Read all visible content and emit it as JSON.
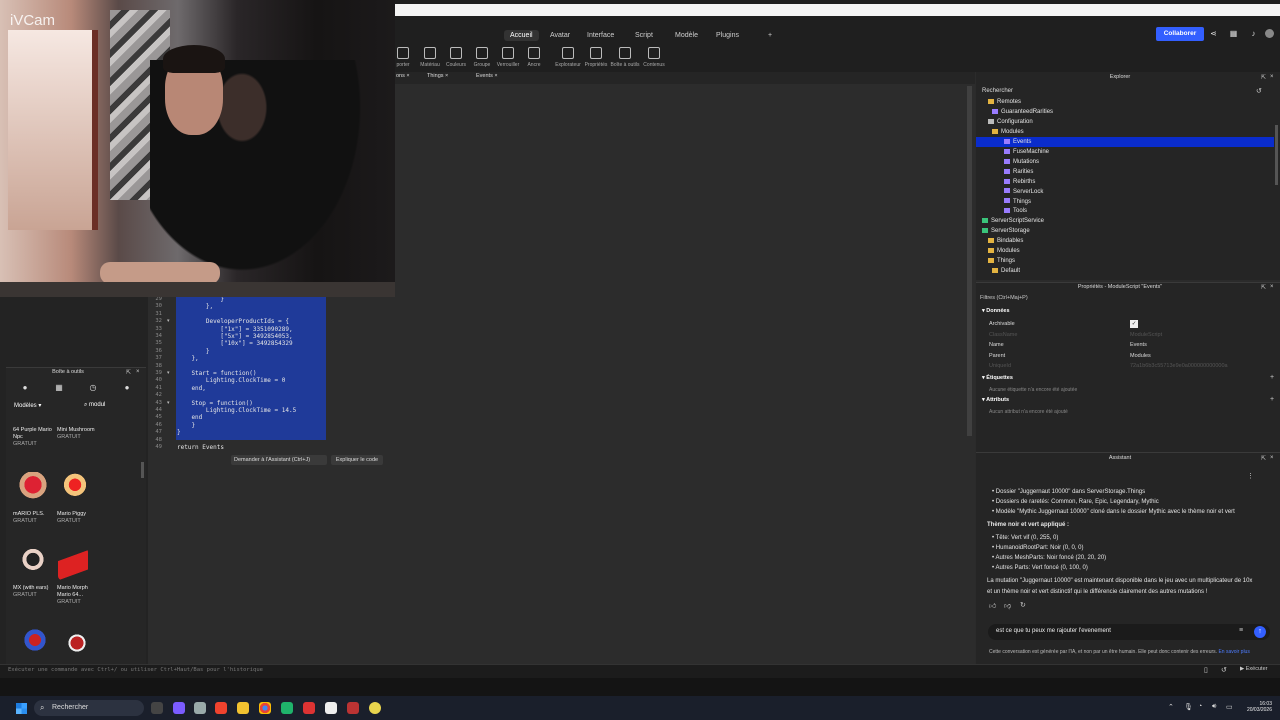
{
  "webcam": {
    "overlay_label": "iVCam"
  },
  "ribbon": {
    "tabs": [
      "Accueil",
      "Avatar",
      "Interface",
      "Script",
      "Modèle",
      "Plugins"
    ],
    "active_tab": "Accueil",
    "tools": [
      "porter",
      "Matériau",
      "Couleurs",
      "Groupe",
      "Verrouiller",
      "Ancre",
      "Explorateur",
      "Propriétés",
      "Boîte à outils",
      "Contenus"
    ],
    "collaborate_label": "Collaborer"
  },
  "doc_tabs": [
    "ons",
    "Things",
    "Events"
  ],
  "code": {
    "line_numbers": [
      "29",
      "30",
      "31",
      "32",
      "33",
      "34",
      "35",
      "36",
      "37",
      "38",
      "39",
      "40",
      "41",
      "42",
      "43",
      "44",
      "45",
      "46",
      "47",
      "48",
      "49"
    ],
    "lines": [
      "            }",
      "        },",
      "",
      "        DeveloperProductIds = {",
      "            [\"1x\"] = 3351090289,",
      "            [\"5x\"] = 3492854053,",
      "            [\"10x\"] = 3492854329",
      "        }",
      "    },",
      "",
      "    Start = function()",
      "        Lighting.ClockTime = 0",
      "    end,",
      "",
      "    Stop = function()",
      "        Lighting.ClockTime = 14.5",
      "    end",
      "    }",
      "}",
      "",
      "return Events"
    ],
    "ask_assistant": "Demander à l'Assistant (Ctrl+J)",
    "explain_code": "Expliquer le code"
  },
  "toolbox": {
    "title": "Boîte à outils",
    "category": "Modèles",
    "search_value": "modul",
    "items": [
      {
        "name": "64 Purple Mario Npc",
        "price": "GRATUIT"
      },
      {
        "name": "Mini Mushroom",
        "price": "GRATUIT"
      },
      {
        "name": "mARIO PLS.",
        "price": "GRATUIT"
      },
      {
        "name": "Mario Piggy",
        "price": "GRATUIT"
      },
      {
        "name": "MX (with ears)",
        "price": "GRATUIT"
      },
      {
        "name": "Mario Morph Mario 64...",
        "price": "GRATUIT"
      }
    ]
  },
  "explorer": {
    "title": "Explorer",
    "search_label": "Rechercher",
    "tree": [
      {
        "label": "Remotes",
        "icon": "folder"
      },
      {
        "label": "GuaranteedRarities",
        "icon": "module"
      },
      {
        "label": "Configuration",
        "icon": "gear"
      },
      {
        "label": "Modules",
        "icon": "folder"
      },
      {
        "label": "Events",
        "icon": "module",
        "selected": true
      },
      {
        "label": "FuseMachine",
        "icon": "module"
      },
      {
        "label": "Mutations",
        "icon": "module"
      },
      {
        "label": "Rarities",
        "icon": "module"
      },
      {
        "label": "Rebirths",
        "icon": "module"
      },
      {
        "label": "ServerLock",
        "icon": "module"
      },
      {
        "label": "Things",
        "icon": "module"
      },
      {
        "label": "Tools",
        "icon": "module"
      },
      {
        "label": "ServerScriptService",
        "icon": "service"
      },
      {
        "label": "ServerStorage",
        "icon": "service"
      },
      {
        "label": "Bindables",
        "icon": "folder"
      },
      {
        "label": "Modules",
        "icon": "folder"
      },
      {
        "label": "Things",
        "icon": "folder"
      },
      {
        "label": "Default",
        "icon": "folder"
      }
    ]
  },
  "properties": {
    "title": "Propriétés - ModuleScript \"Events\"",
    "filter": "Filtres (Ctrl+Maj+P)",
    "sections": {
      "data": "Données",
      "tags": "Étiquettes",
      "attributes": "Attributs"
    },
    "rows": [
      {
        "key": "Archivable",
        "value": "✓"
      },
      {
        "key": "ClassName",
        "value": "ModuleScript"
      },
      {
        "key": "Name",
        "value": "Events"
      },
      {
        "key": "Parent",
        "value": "Modules"
      },
      {
        "key": "UniqueId",
        "value": "72a1b6b3c55713e9e0a000000000000a"
      }
    ],
    "tags_note": "Aucune étiquette n'a encore été ajoutée",
    "attributes_note": "Aucun attribut n'a encore été ajouté"
  },
  "assistant": {
    "title": "Assistant",
    "bullets_1": [
      "Dossier \"Juggernaut 10000\" dans ServerStorage.Things",
      "Dossiers de raretés: Common, Rare, Epic, Legendary, Mythic",
      "Modèle \"Mythic Juggernaut 10000\" cloné dans le dossier Mythic avec le thème noir et vert"
    ],
    "theme_heading": "Thème noir et vert appliqué :",
    "bullets_2": [
      "Tête: Vert vif (0, 255, 0)",
      "HumanoidRootPart: Noir (0, 0, 0)",
      "Autres MeshParts: Noir foncé (20, 20, 20)",
      "Autres Parts: Vert foncé (0, 100, 0)"
    ],
    "summary_1": "La mutation \"Juggernaut 10000\" est maintenant disponible dans le jeu avec un multiplicateur de 10x",
    "summary_2": "et un thème noir et vert distinctif qui le différencie clairement des autres mutations !",
    "input_value": "est ce que tu peux me rajouter l'evenement",
    "footer": "Cette conversation est générée par l'IA, et non par un être humain. Elle peut donc contenir des erreurs.",
    "footer_link": "En savoir plus"
  },
  "command_bar": {
    "placeholder": "Exécuter une commande avec Ctrl+/ ou utiliser Ctrl+Haut/Bas pour l'historique",
    "run_label": "Exécuter"
  },
  "taskbar": {
    "search_label": "Rechercher",
    "time": "16:03",
    "date": "20/03/2026"
  },
  "colors": {
    "accent": "#335fff",
    "selection": "#0a2ccc",
    "code_selection": "#1f3a99"
  }
}
